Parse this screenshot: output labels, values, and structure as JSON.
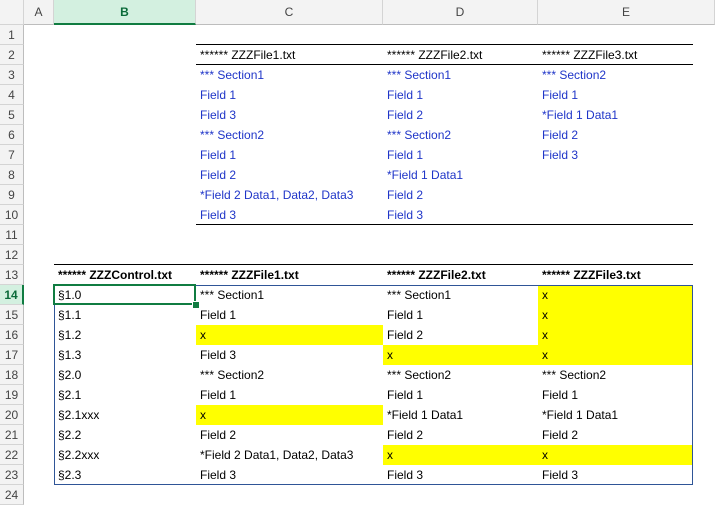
{
  "columns": [
    "A",
    "B",
    "C",
    "D",
    "E"
  ],
  "rows": [
    "1",
    "2",
    "3",
    "4",
    "5",
    "6",
    "7",
    "8",
    "9",
    "10",
    "11",
    "12",
    "13",
    "14",
    "15",
    "16",
    "17",
    "18",
    "19",
    "20",
    "21",
    "22",
    "23",
    "24"
  ],
  "selected_cell": {
    "column": "B",
    "row": "14"
  },
  "top_table": {
    "headers": [
      "****** ZZZFile1.txt",
      "****** ZZZFile2.txt",
      "****** ZZZFile3.txt"
    ],
    "rows": [
      [
        "*** Section1",
        "*** Section1",
        "*** Section2"
      ],
      [
        "Field 1",
        "Field 1",
        "Field 1"
      ],
      [
        "Field 3",
        "Field 2",
        "*Field 1  Data1"
      ],
      [
        "*** Section2",
        "*** Section2",
        "Field 2"
      ],
      [
        "Field 1",
        "Field 1",
        "Field 3"
      ],
      [
        "Field 2",
        "*Field 1  Data1",
        ""
      ],
      [
        "*Field 2  Data1, Data2, Data3",
        "Field 2",
        ""
      ],
      [
        "Field 3",
        "Field 3",
        ""
      ]
    ]
  },
  "bottom_table": {
    "headers": [
      "****** ZZZControl.txt",
      "****** ZZZFile1.txt",
      "****** ZZZFile2.txt",
      "****** ZZZFile3.txt"
    ],
    "rows": [
      [
        "§1.0",
        "*** Section1",
        "*** Section1",
        "x"
      ],
      [
        "§1.1",
        "Field 1",
        "Field 1",
        "x"
      ],
      [
        "§1.2",
        "x",
        "Field 2",
        "x"
      ],
      [
        "§1.3",
        "Field 3",
        "x",
        "x"
      ],
      [
        "§2.0",
        "*** Section2",
        "*** Section2",
        "*** Section2"
      ],
      [
        "§2.1",
        "Field 1",
        "Field 1",
        "Field 1"
      ],
      [
        "§2.1xxx",
        "x",
        "*Field 1  Data1",
        "*Field 1  Data1"
      ],
      [
        "§2.2",
        "Field 2",
        "Field 2",
        "Field 2"
      ],
      [
        "§2.2xxx",
        "*Field 2  Data1, Data2, Data3",
        "x",
        "x"
      ],
      [
        "§2.3",
        "Field 3",
        "Field 3",
        "Field 3"
      ]
    ],
    "highlight": [
      [
        false,
        false,
        false,
        true
      ],
      [
        false,
        false,
        false,
        true
      ],
      [
        false,
        true,
        false,
        true
      ],
      [
        false,
        false,
        true,
        true
      ],
      [
        false,
        false,
        false,
        false
      ],
      [
        false,
        false,
        false,
        false
      ],
      [
        false,
        true,
        false,
        false
      ],
      [
        false,
        false,
        false,
        false
      ],
      [
        false,
        false,
        true,
        true
      ],
      [
        false,
        false,
        false,
        false
      ]
    ]
  },
  "colors": {
    "highlight": "#ffff00",
    "text_blue": "#1f35c8",
    "selection_green": "#107c41"
  }
}
